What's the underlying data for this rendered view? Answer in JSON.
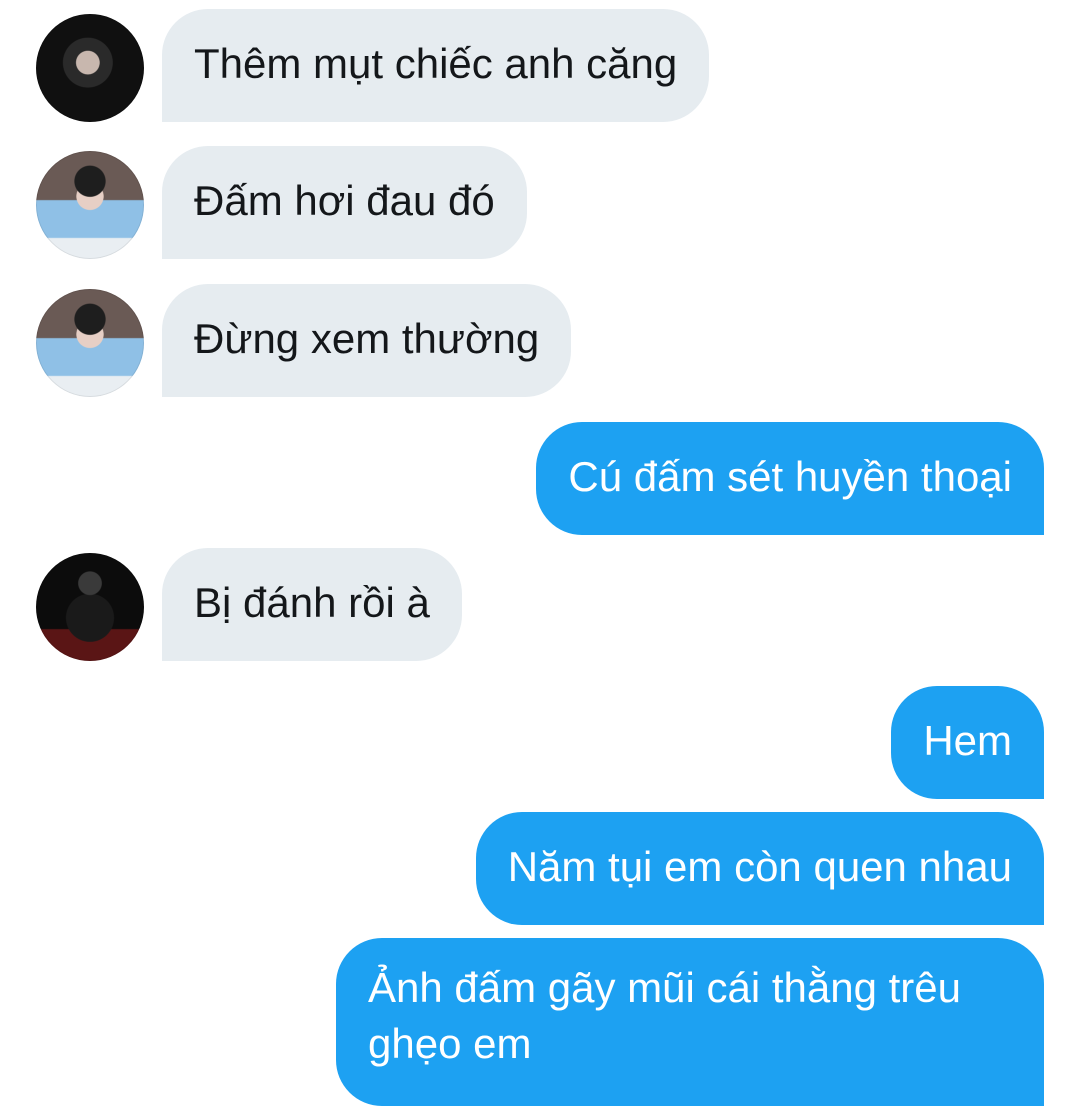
{
  "messages": [
    {
      "direction": "incoming",
      "avatar": "avatar-user-dark-hair-hand",
      "text": "Thêm mụt chiếc anh căng"
    },
    {
      "direction": "incoming",
      "avatar": "avatar-user-blue-hanbok",
      "text": "Đấm hơi đau đó"
    },
    {
      "direction": "incoming",
      "avatar": "avatar-user-blue-hanbok",
      "text": "Đừng xem thường"
    },
    {
      "direction": "outgoing",
      "text": "Cú đấm sét huyền thoại"
    },
    {
      "direction": "incoming",
      "avatar": "avatar-user-black-outfit",
      "text": "Bị đánh rồi à"
    },
    {
      "direction": "outgoing",
      "text": "Hem"
    },
    {
      "direction": "outgoing",
      "text": "Năm tụi em còn quen nhau"
    },
    {
      "direction": "outgoing",
      "text": "Ảnh đấm gãy mũi cái thằng trêu ghẹo em"
    }
  ],
  "colors": {
    "incoming_bubble": "#e6ecf0",
    "outgoing_bubble": "#1da1f2",
    "incoming_text": "#14171a",
    "outgoing_text": "#ffffff"
  }
}
